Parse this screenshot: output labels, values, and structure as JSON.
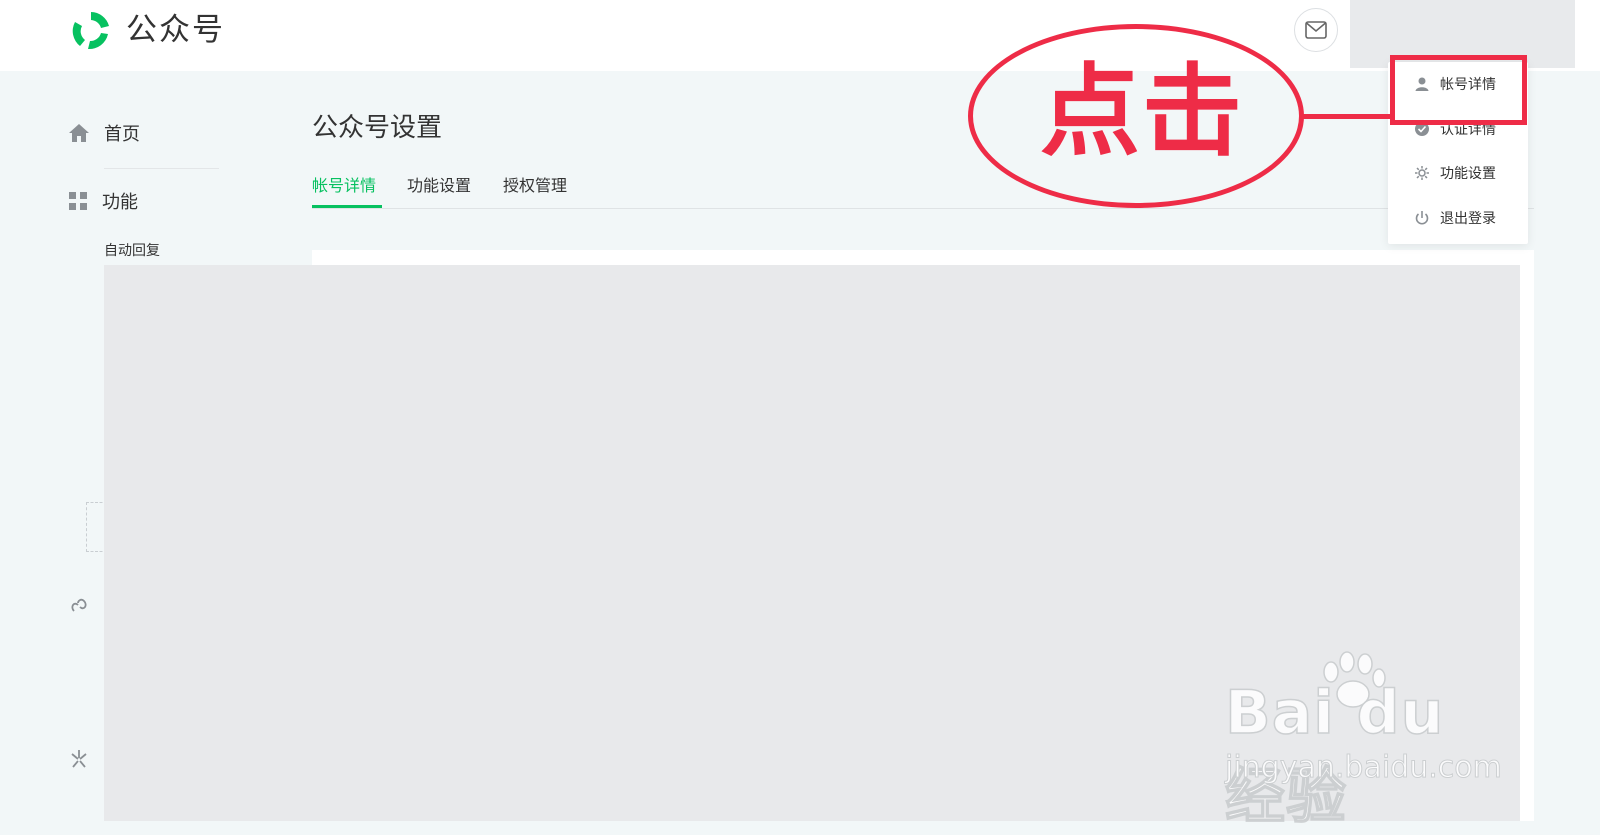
{
  "header": {
    "brand": "公众号",
    "mail_icon": "mail-icon"
  },
  "sidebar": {
    "home_label": "首页",
    "function_label": "功能",
    "sub_items": [
      "自动回复"
    ]
  },
  "main": {
    "title": "公众号设置",
    "tabs": [
      {
        "label": "帐号详情",
        "active": true
      },
      {
        "label": "功能设置",
        "active": false
      },
      {
        "label": "授权管理",
        "active": false
      }
    ]
  },
  "dropdown": {
    "items": [
      {
        "label": "帐号详情",
        "icon": "user-icon"
      },
      {
        "label": "认证详情",
        "icon": "check-circle-icon"
      },
      {
        "label": "功能设置",
        "icon": "gear-icon"
      },
      {
        "label": "退出登录",
        "icon": "power-icon"
      }
    ]
  },
  "annotation": {
    "text": "点击",
    "color": "#ee2c47"
  },
  "watermark": {
    "brand": "Bai du 经验",
    "url": "jingyan.baidu.com"
  },
  "colors": {
    "accent": "#07c160",
    "background": "#f2f7f8",
    "annotation": "#ee2c47"
  }
}
